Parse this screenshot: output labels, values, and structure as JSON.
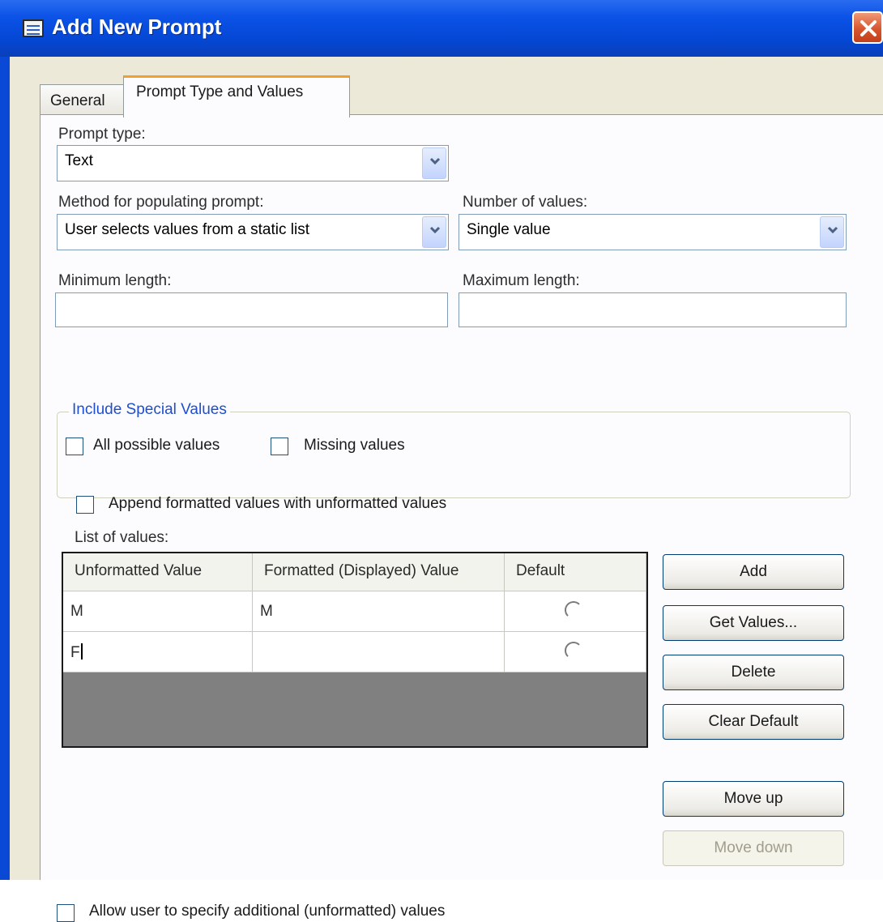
{
  "window": {
    "title": "Add New Prompt"
  },
  "tabs": [
    {
      "label": "General"
    },
    {
      "label": "Prompt Type and Values"
    }
  ],
  "prompt_type": {
    "label": "Prompt type:",
    "value": "Text"
  },
  "method": {
    "label": "Method for populating prompt:",
    "value": "User selects values from a static list"
  },
  "number_of_values": {
    "label": "Number of values:",
    "value": "Single value"
  },
  "min_length": {
    "label": "Minimum length:",
    "value": ""
  },
  "max_length": {
    "label": "Maximum length:",
    "value": ""
  },
  "special_values": {
    "title": "Include Special Values",
    "all_possible": {
      "label": "All possible values",
      "checked": false
    },
    "missing": {
      "label": "Missing values",
      "checked": false
    }
  },
  "append_formatted": {
    "label": "Append formatted values with unformatted values",
    "checked": false
  },
  "list": {
    "label": "List of values:",
    "columns": [
      "Unformatted Value",
      "Formatted (Displayed) Value",
      "Default"
    ],
    "rows": [
      {
        "unformatted": "M",
        "formatted": "M",
        "default": false
      },
      {
        "unformatted": "F",
        "formatted": "",
        "default": false
      }
    ]
  },
  "buttons": {
    "add": "Add",
    "get_values": "Get Values...",
    "delete": "Delete",
    "clear_default": "Clear Default",
    "move_up": "Move up",
    "move_down": "Move down"
  },
  "allow_additional": {
    "label": "Allow user to specify additional (unformatted) values",
    "checked": false
  },
  "colors": {
    "titlebar": "#0b52e6",
    "dialog_bg": "#ece9d8",
    "grid_empty": "#808080",
    "group_title": "#1f4fcc"
  }
}
